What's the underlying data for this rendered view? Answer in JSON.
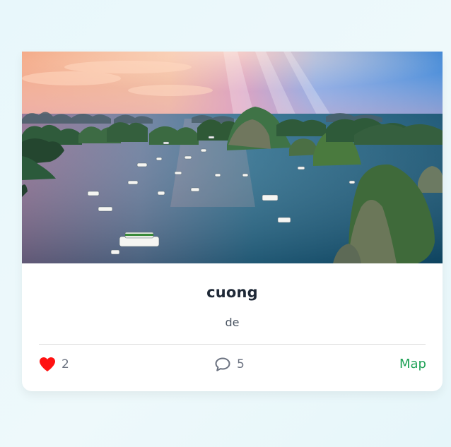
{
  "card": {
    "title": "cuong",
    "subtitle": "de",
    "likes": "2",
    "comments": "5",
    "map_label": "Map"
  },
  "icons": {
    "like": "heart-icon",
    "comment": "comment-icon"
  },
  "colors": {
    "heart": "#ff1111",
    "map_link": "#1fa257",
    "card_background": "#ffffff",
    "page_background": "#e8f7fb"
  }
}
